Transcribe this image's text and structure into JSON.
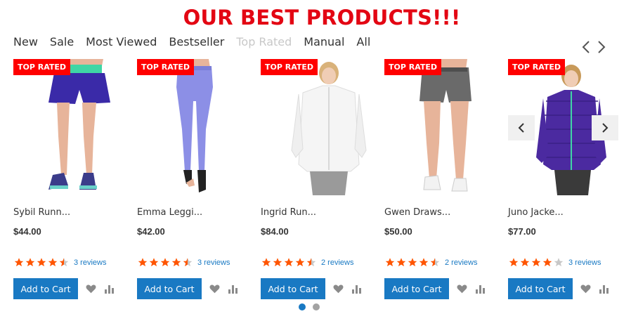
{
  "heading": "OUR BEST PRODUCTS!!!",
  "tabs": [
    {
      "label": "New"
    },
    {
      "label": "Sale"
    },
    {
      "label": "Most Viewed"
    },
    {
      "label": "Bestseller"
    },
    {
      "label": "Top Rated",
      "active": true
    },
    {
      "label": "Manual"
    },
    {
      "label": "All"
    }
  ],
  "nav": {
    "prev_icon": "chevron-left-icon",
    "next_icon": "chevron-right-icon"
  },
  "products": [
    {
      "badge": "TOP RATED",
      "name": "Sybil Runn...",
      "price": "$44.00",
      "rating_stars": 4.5,
      "reviews": "3 reviews",
      "add_to_cart": "Add to Cart"
    },
    {
      "badge": "TOP RATED",
      "name": "Emma Leggi...",
      "price": "$42.00",
      "rating_stars": 4.5,
      "reviews": "3 reviews",
      "add_to_cart": "Add to Cart"
    },
    {
      "badge": "TOP RATED",
      "name": "Ingrid Run...",
      "price": "$84.00",
      "rating_stars": 4.5,
      "reviews": "2 reviews",
      "add_to_cart": "Add to Cart"
    },
    {
      "badge": "TOP RATED",
      "name": "Gwen Draws...",
      "price": "$50.00",
      "rating_stars": 4.5,
      "reviews": "2 reviews",
      "add_to_cart": "Add to Cart"
    },
    {
      "badge": "TOP RATED",
      "name": "Juno Jacke...",
      "price": "$77.00",
      "rating_stars": 4,
      "reviews": "3 reviews",
      "add_to_cart": "Add to Cart"
    }
  ],
  "pagination": {
    "pages": 2,
    "active": 1
  },
  "colors": {
    "accent": "#1979c3",
    "badge": "#ff0000",
    "title": "#e30613",
    "star": "#ff5501",
    "star_empty": "#c7c7c7"
  }
}
